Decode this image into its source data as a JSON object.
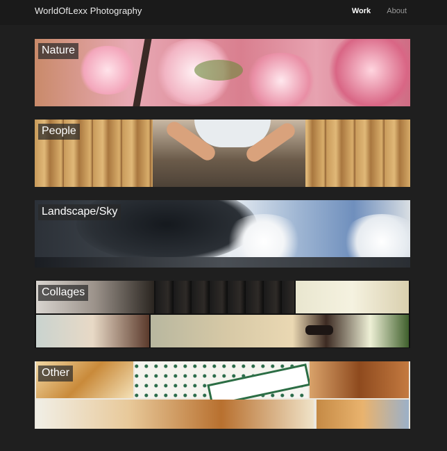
{
  "header": {
    "brand": "WorldOfLexx Photography",
    "nav": [
      {
        "label": "Work",
        "active": true
      },
      {
        "label": "About",
        "active": false
      }
    ]
  },
  "categories": [
    {
      "label": "Nature"
    },
    {
      "label": "People"
    },
    {
      "label": "Landscape/Sky"
    },
    {
      "label": "Collages"
    },
    {
      "label": "Other"
    }
  ],
  "colors": {
    "background": "#1f1f1f",
    "topbar": "#1a1a1a",
    "label_bg": "rgba(40,40,40,0.72)"
  }
}
